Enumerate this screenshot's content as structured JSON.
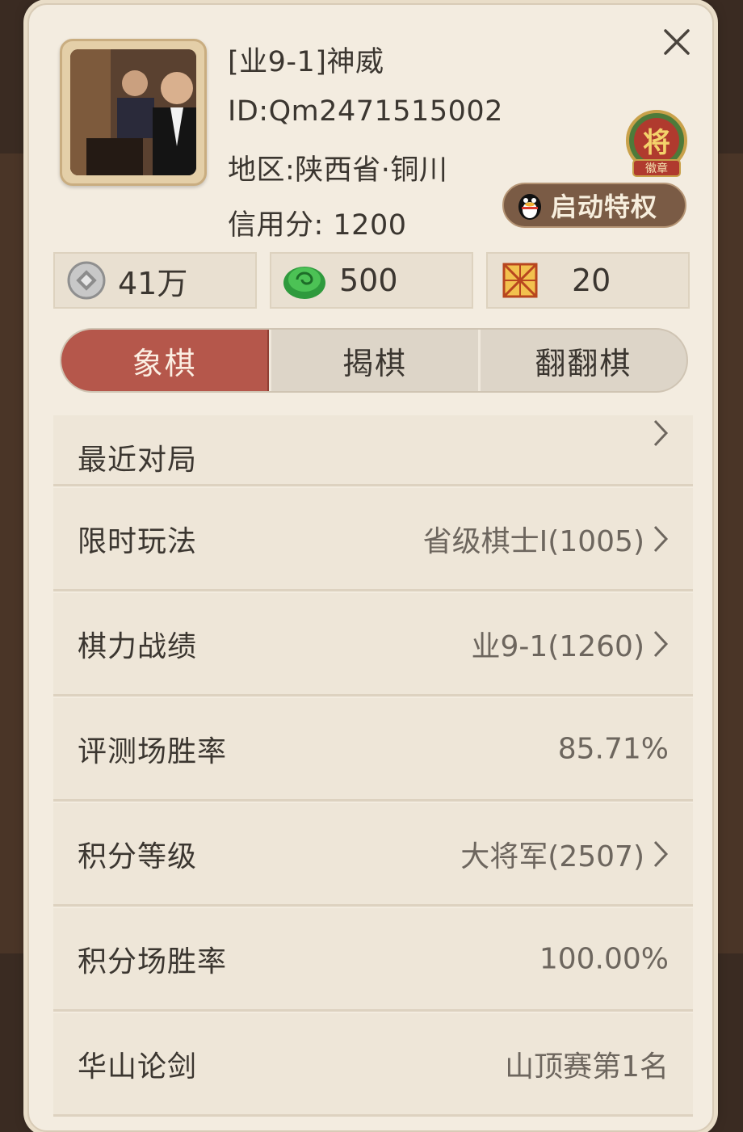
{
  "profile": {
    "name": "[业9-1]神威",
    "id_line": "ID:Qm2471515002",
    "region_line": "地区:陕西省·铜川",
    "credit_line": "信用分: 1200",
    "badge_text_top": "将",
    "badge_text_bottom": "徽章",
    "privilege_label": "启动特权"
  },
  "currency": [
    {
      "icon": "silver-coin-icon",
      "value": "41万"
    },
    {
      "icon": "jade-icon",
      "value": "500"
    },
    {
      "icon": "chessboard-icon",
      "value": "20"
    }
  ],
  "tabs": [
    {
      "label": "象棋",
      "active": true
    },
    {
      "label": "揭棋",
      "active": false
    },
    {
      "label": "翻翻棋",
      "active": false
    }
  ],
  "rows": [
    {
      "label": "最近对局",
      "value": "",
      "chevron": true
    },
    {
      "label": "限时玩法",
      "value": "省级棋士I(1005)",
      "chevron": true
    },
    {
      "label": "棋力战绩",
      "value": "业9-1(1260)",
      "chevron": true
    },
    {
      "label": "评测场胜率",
      "value": "85.71%",
      "chevron": false
    },
    {
      "label": "积分等级",
      "value": "大将军(2507)",
      "chevron": true
    },
    {
      "label": "积分场胜率",
      "value": "100.00%",
      "chevron": false
    },
    {
      "label": "华山论剑",
      "value": "山顶赛第1名",
      "chevron": false
    }
  ],
  "colors": {
    "panel": "#f3ece0",
    "active_tab": "#b5574b",
    "privilege_button": "#7a5b45"
  }
}
